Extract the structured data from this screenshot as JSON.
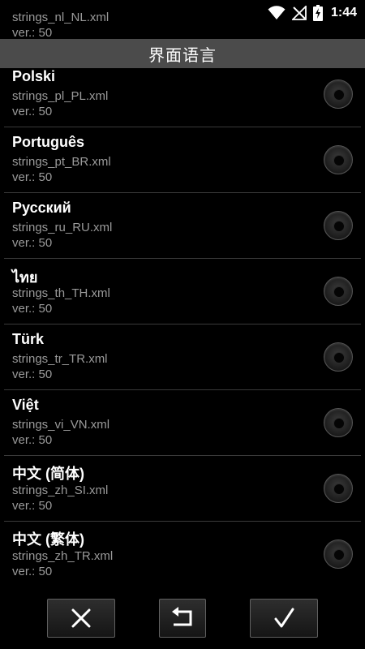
{
  "status_bar": {
    "time": "1:44",
    "icons": [
      "wifi-icon",
      "signal-off-icon",
      "battery-charging-icon"
    ]
  },
  "title": "界面语言",
  "partial_top": {
    "file": "strings_nl_NL.xml",
    "version": "ver.: 50"
  },
  "languages": [
    {
      "name": "Polski",
      "file": "strings_pl_PL.xml",
      "version": "ver.: 50",
      "selected": false
    },
    {
      "name": "Português",
      "file": "strings_pt_BR.xml",
      "version": "ver.: 50",
      "selected": false
    },
    {
      "name": "Русский",
      "file": "strings_ru_RU.xml",
      "version": "ver.: 50",
      "selected": false
    },
    {
      "name": "ไทย",
      "file": "strings_th_TH.xml",
      "version": "ver.: 50",
      "selected": false
    },
    {
      "name": "Türk",
      "file": "strings_tr_TR.xml",
      "version": "ver.: 50",
      "selected": false
    },
    {
      "name": "Việt",
      "file": "strings_vi_VN.xml",
      "version": "ver.: 50",
      "selected": false
    },
    {
      "name": "中文 (简体)",
      "file": "strings_zh_SI.xml",
      "version": "ver.: 50",
      "selected": false
    },
    {
      "name": "中文 (繁体)",
      "file": "strings_zh_TR.xml",
      "version": "ver.: 50",
      "selected": false
    }
  ],
  "buttons": {
    "cancel_icon": "close-icon",
    "reset_icon": "undo-icon",
    "confirm_icon": "checkmark-icon"
  },
  "colors": {
    "background": "#000000",
    "title_bar": "#4b4b4b",
    "secondary_text": "#9a9a9a",
    "divider": "#3a3a3a"
  }
}
